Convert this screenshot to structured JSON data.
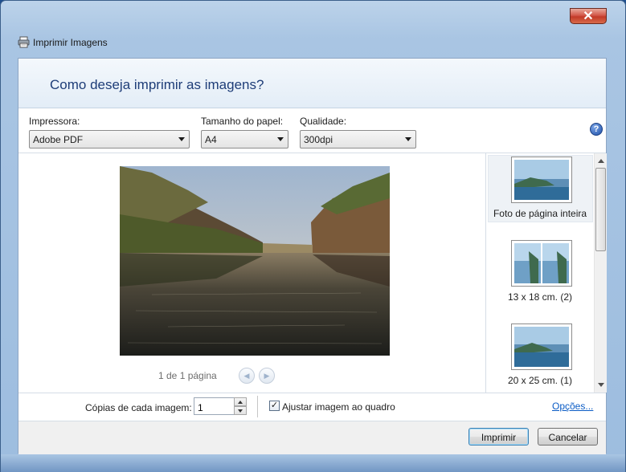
{
  "window": {
    "title": "Imprimir Imagens",
    "close_glyph": "✕"
  },
  "header": {
    "heading": "Como deseja imprimir as imagens?"
  },
  "controls": {
    "printer_label": "Impressora:",
    "printer_value": "Adobe PDF",
    "paper_label": "Tamanho do papel:",
    "paper_value": "A4",
    "quality_label": "Qualidade:",
    "quality_value": "300dpi",
    "help_glyph": "?"
  },
  "preview": {
    "page_info": "1 de 1 página",
    "prev_glyph": "◀",
    "next_glyph": "▶"
  },
  "layouts": [
    {
      "caption": "Foto de página inteira",
      "selected": true
    },
    {
      "caption": "13 x 18 cm. (2)",
      "selected": false
    },
    {
      "caption": "20 x 25 cm. (1)",
      "selected": false
    }
  ],
  "bottom": {
    "copies_label": "Cópias de cada imagem:",
    "copies_value": "1",
    "fit_checked": true,
    "fit_check_glyph": "✓",
    "fit_label": "Ajustar imagem ao quadro",
    "options_link": "Opções..."
  },
  "footer": {
    "print_button": "Imprimir",
    "cancel_button": "Cancelar"
  },
  "colors": {
    "heading": "#1e3d78",
    "link": "#0b5cc5",
    "frame": "#a9c5e3"
  }
}
